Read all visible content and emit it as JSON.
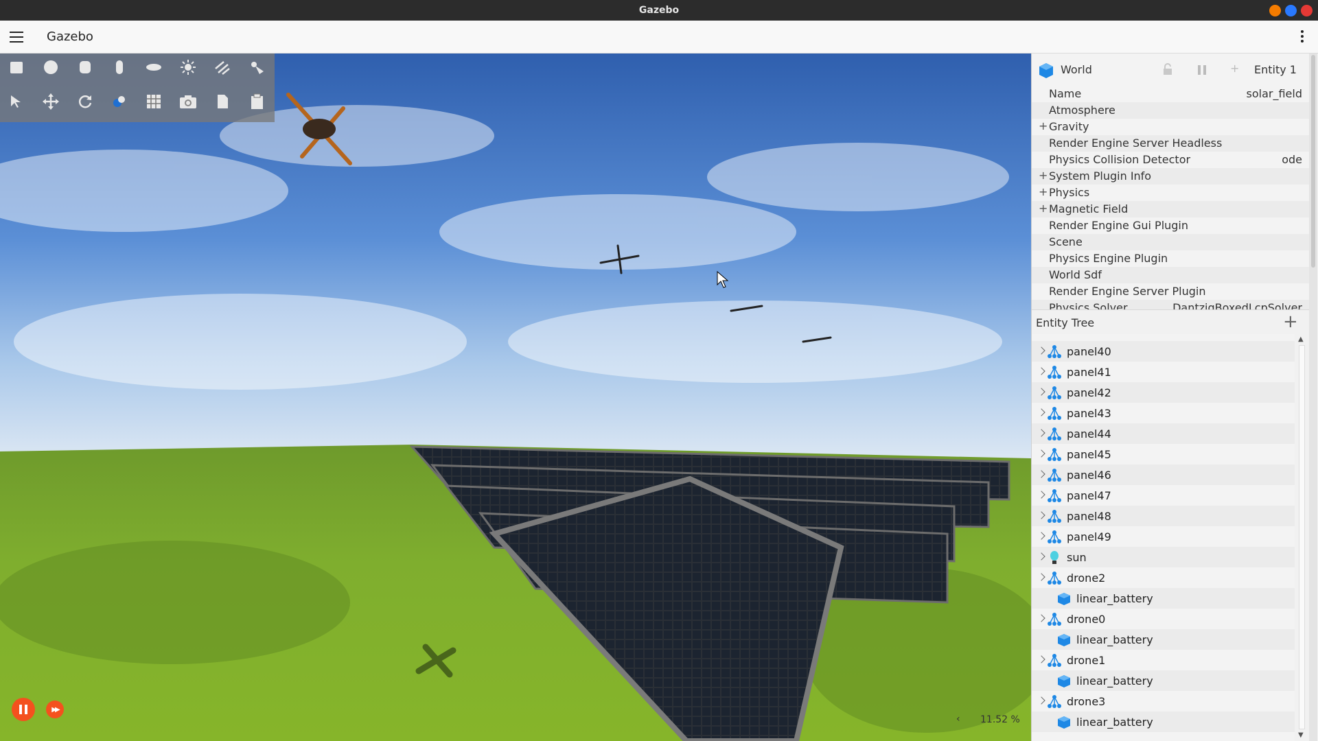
{
  "window": {
    "title": "Gazebo",
    "buttons": [
      {
        "name": "minimize",
        "color": "#f57c00"
      },
      {
        "name": "maximize",
        "color": "#2979ff"
      },
      {
        "name": "close",
        "color": "#e53935"
      }
    ]
  },
  "appbar": {
    "title": "Gazebo"
  },
  "toolbar": {
    "row1": [
      "box-icon",
      "sphere-icon",
      "cylinder-icon",
      "capsule-icon",
      "ellipsoid-icon",
      "sun-icon",
      "directional-light-icon",
      "spot-light-icon"
    ],
    "row2": [
      "select-icon",
      "translate-icon",
      "rotate-icon",
      "transform-icon",
      "grid-icon",
      "camera-icon",
      "copy-icon",
      "paste-icon"
    ]
  },
  "playback": {
    "state": "playing",
    "rtf": "11.52 %"
  },
  "component_inspector": {
    "entity_type": "World",
    "entity_label": "Entity 1",
    "properties": [
      {
        "label": "Name",
        "value": "solar_field",
        "expandable": false
      },
      {
        "label": "Atmosphere",
        "value": "",
        "expandable": false
      },
      {
        "label": "Gravity",
        "value": "",
        "expandable": true
      },
      {
        "label": "Render Engine Server Headless",
        "value": "",
        "expandable": false
      },
      {
        "label": "Physics Collision Detector",
        "value": "ode",
        "expandable": false
      },
      {
        "label": "System Plugin Info",
        "value": "",
        "expandable": true
      },
      {
        "label": "Physics",
        "value": "",
        "expandable": true
      },
      {
        "label": "Magnetic Field",
        "value": "",
        "expandable": true
      },
      {
        "label": "Render Engine Gui Plugin",
        "value": "",
        "expandable": false
      },
      {
        "label": "Scene",
        "value": "",
        "expandable": false
      },
      {
        "label": "Physics Engine Plugin",
        "value": "",
        "expandable": false
      },
      {
        "label": "World Sdf",
        "value": "",
        "expandable": false
      },
      {
        "label": "Render Engine Server Plugin",
        "value": "",
        "expandable": false
      },
      {
        "label": "Physics Solver",
        "value": "DantzigBoxedLcpSolver",
        "expandable": false
      }
    ]
  },
  "entity_tree": {
    "title": "Entity Tree",
    "items": [
      {
        "name": "panel40",
        "type": "model",
        "level": 0
      },
      {
        "name": "panel41",
        "type": "model",
        "level": 0
      },
      {
        "name": "panel42",
        "type": "model",
        "level": 0
      },
      {
        "name": "panel43",
        "type": "model",
        "level": 0
      },
      {
        "name": "panel44",
        "type": "model",
        "level": 0
      },
      {
        "name": "panel45",
        "type": "model",
        "level": 0
      },
      {
        "name": "panel46",
        "type": "model",
        "level": 0
      },
      {
        "name": "panel47",
        "type": "model",
        "level": 0
      },
      {
        "name": "panel48",
        "type": "model",
        "level": 0
      },
      {
        "name": "panel49",
        "type": "model",
        "level": 0
      },
      {
        "name": "sun",
        "type": "light",
        "level": 0
      },
      {
        "name": "drone2",
        "type": "model",
        "level": 0
      },
      {
        "name": "linear_battery",
        "type": "plugin",
        "level": 1
      },
      {
        "name": "drone0",
        "type": "model",
        "level": 0
      },
      {
        "name": "linear_battery",
        "type": "plugin",
        "level": 1
      },
      {
        "name": "drone1",
        "type": "model",
        "level": 0
      },
      {
        "name": "linear_battery",
        "type": "plugin",
        "level": 1
      },
      {
        "name": "drone3",
        "type": "model",
        "level": 0
      },
      {
        "name": "linear_battery",
        "type": "plugin",
        "level": 1
      }
    ]
  }
}
